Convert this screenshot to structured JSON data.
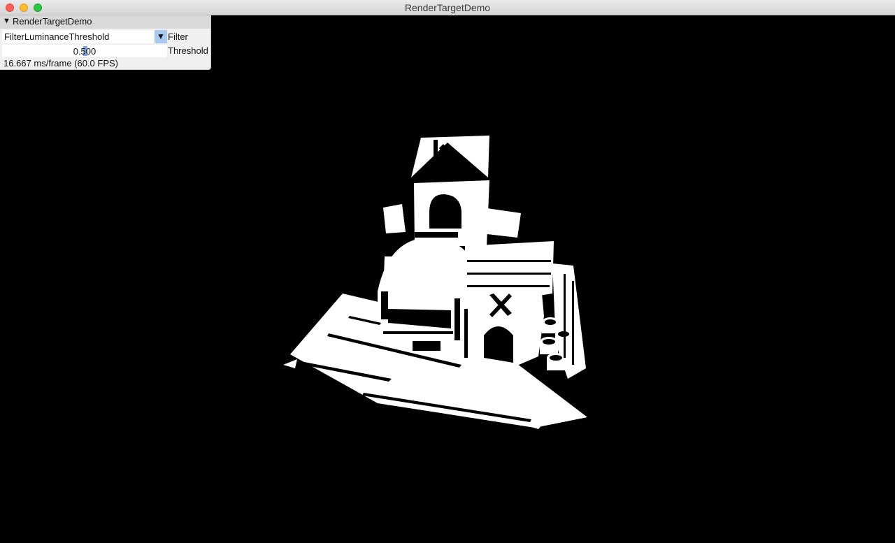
{
  "window": {
    "title": "RenderTargetDemo"
  },
  "panel": {
    "title": "RenderTargetDemo",
    "filter": {
      "value": "FilterLuminanceThreshold",
      "label": "Filter"
    },
    "threshold": {
      "value": "0.500",
      "label": "Threshold"
    },
    "stats": "16.667 ms/frame (60.0 FPS)"
  },
  "colors": {
    "background": "#000000",
    "panel": "#f0f0f0",
    "panel_header": "#d9d9d9",
    "accent": "#a9c8f2"
  }
}
